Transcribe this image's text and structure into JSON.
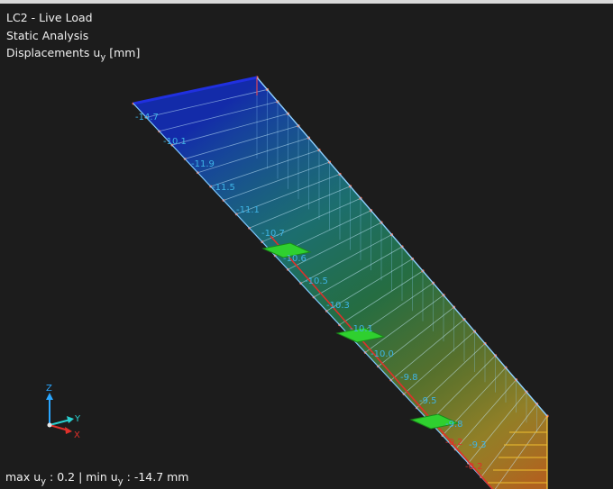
{
  "header": {
    "load_case": "LC2 - Live Load",
    "analysis": "Static Analysis",
    "result_prefix": "Displacements u",
    "result_sub": "y",
    "result_unit": " [mm]"
  },
  "status": {
    "max_prefix": "max u",
    "max_sub": "y",
    "max_value": " : 0.2 | min u",
    "min_sub": "y",
    "min_value": " : -14.7 mm"
  },
  "axes": {
    "z": "Z",
    "y": "Y",
    "x": "X"
  },
  "colors": {
    "background": "#1c1c1c",
    "label_blue": "#3fb4e6",
    "label_red": "#e0302a",
    "support": "#2fd02f",
    "beam_edge": "#8fd0ff"
  },
  "value_labels": [
    {
      "text": "-14.7",
      "color": "#3fb4e6"
    },
    {
      "text": "-10.1",
      "color": "#3fb4e6"
    },
    {
      "text": "-11.9",
      "color": "#3fb4e6"
    },
    {
      "text": "-11.5",
      "color": "#3fb4e6"
    },
    {
      "text": "-11.1",
      "color": "#3fb4e6"
    },
    {
      "text": "-10.7",
      "color": "#3fb4e6"
    },
    {
      "text": "-10.6",
      "color": "#3fb4e6"
    },
    {
      "text": "-10.5",
      "color": "#3fb4e6"
    },
    {
      "text": "-10.3",
      "color": "#3fb4e6"
    },
    {
      "text": "-10.1",
      "color": "#3fb4e6"
    },
    {
      "text": "-10.0",
      "color": "#3fb4e6"
    },
    {
      "text": "-9.8",
      "color": "#3fb4e6"
    },
    {
      "text": "-9.5",
      "color": "#3fb4e6"
    },
    {
      "text": "-9.8",
      "color": "#3fb4e6"
    },
    {
      "text": "-9.3",
      "color": "#3fb4e6"
    },
    {
      "text": "-0.2",
      "color": "#e0302a"
    },
    {
      "text": "-0.2",
      "color": "#e0302a"
    }
  ]
}
